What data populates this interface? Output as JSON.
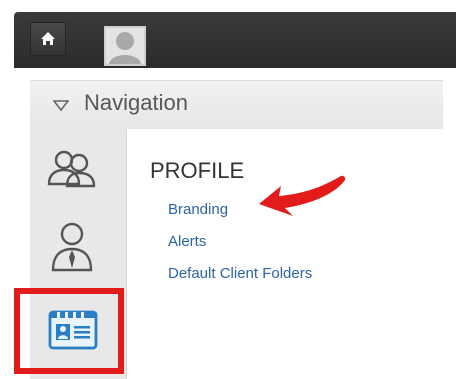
{
  "topbar": {
    "home_icon": "home-icon",
    "avatar_icon": "user-avatar-icon"
  },
  "navigation": {
    "title": "Navigation",
    "caret_icon": "caret-down-icon"
  },
  "sidebar": {
    "items": [
      {
        "icon": "users-icon"
      },
      {
        "icon": "user-icon"
      },
      {
        "icon": "id-card-icon",
        "active": true
      }
    ]
  },
  "profile_menu": {
    "heading": "PROFILE",
    "links": [
      "Branding",
      "Alerts",
      "Default Client Folders"
    ]
  },
  "annotation": {
    "arrow_color": "#e21b1b",
    "highlight_color": "#e21b1b"
  }
}
